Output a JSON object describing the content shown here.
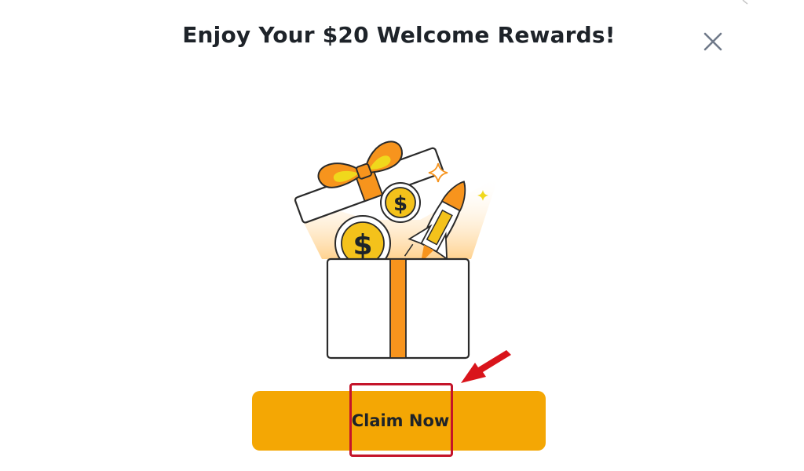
{
  "dialog": {
    "title": "Enjoy Your $20 Welcome Rewards!",
    "close_icon": "close-icon",
    "claim_button_label": "Claim Now"
  },
  "colors": {
    "title_text": "#1e2329",
    "button_bg": "#f4a704",
    "button_text": "#1e2329",
    "ribbon_orange": "#f7941d",
    "ribbon_yellow": "#f0d81c",
    "coin_gold": "#f4c21b",
    "annotation_red": "#d9141b",
    "annotation_box": "#c4142a"
  },
  "icons": {
    "illustration": "gift-box-illustration",
    "coin": "dollar-coin-icon",
    "rocket": "rocket-icon",
    "sparkle": "sparkle-icon",
    "arrow": "red-arrow-pointer"
  }
}
